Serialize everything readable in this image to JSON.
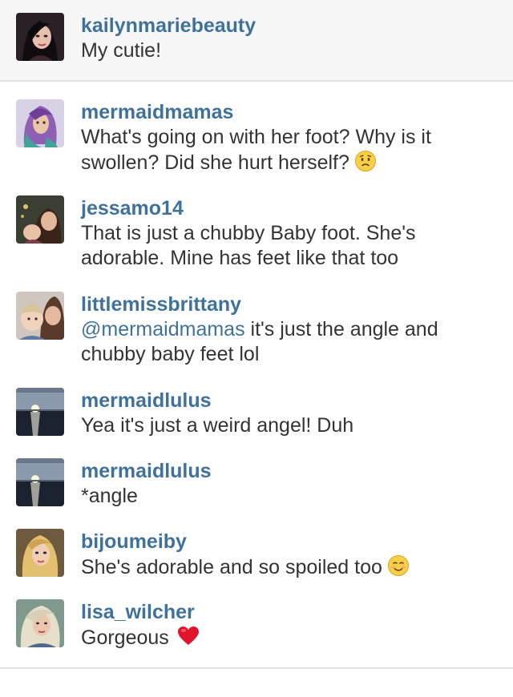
{
  "caption": {
    "username": "kailynmariebeauty",
    "text": "My cutie!"
  },
  "comments": [
    {
      "username": "mermaidmamas",
      "line1": "What's going on with her foot? Why is it",
      "line2": "swollen? Did she hurt herself?",
      "emoji": "worried-face-emoji"
    },
    {
      "username": "jessamo14",
      "line1": "That is just a chubby Baby foot. She's",
      "line2": "adorable. Mine has feet like that too"
    },
    {
      "username": "littlemissbrittany",
      "mention": "@mermaidmamas",
      "line1": " it's just the angle and",
      "line2": "chubby baby feet lol"
    },
    {
      "username": "mermaidlulus",
      "line1": "Yea it's just a weird angel! Duh"
    },
    {
      "username": "mermaidlulus",
      "line1": "*angle"
    },
    {
      "username": "bijoumeiby",
      "line1": "She's adorable and so spoiled too",
      "emoji": "smiling-face-emoji"
    },
    {
      "username": "lisa_wilcher",
      "line1": "Gorgeous",
      "emoji": "red-heart-emoji"
    }
  ],
  "colors": {
    "username": "#3f729b",
    "text": "#333333",
    "caption_bg": "#f7f7f8",
    "divider": "#e2e2e4"
  }
}
